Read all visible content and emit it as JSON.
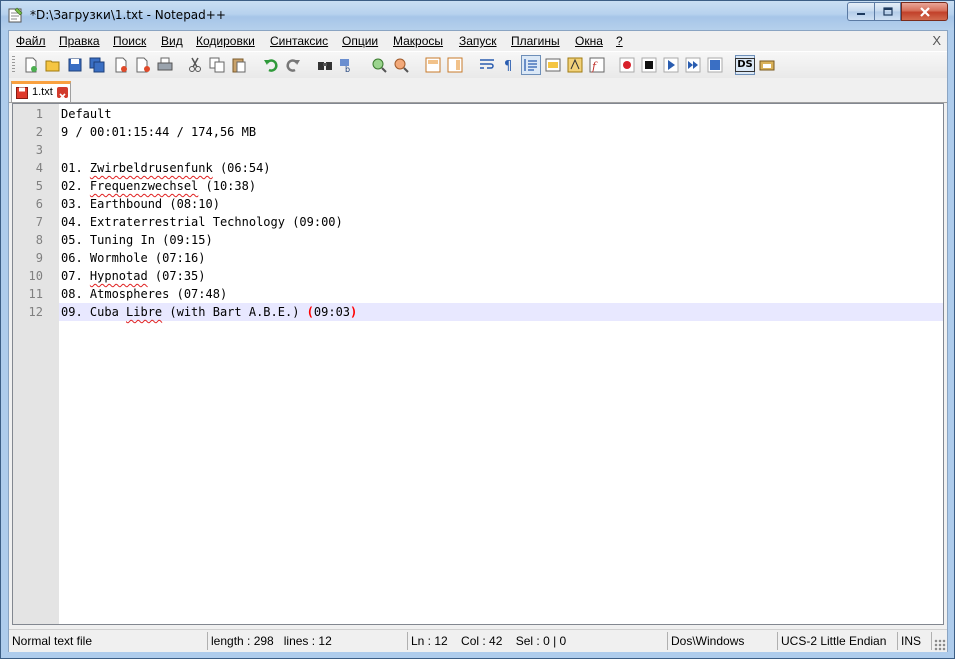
{
  "window": {
    "title": "*D:\\Загрузки\\1.txt - Notepad++",
    "buttons": {
      "minimize": "minimize-icon",
      "maximize": "maximize-icon",
      "close": "close-icon"
    }
  },
  "menu": {
    "items": [
      "Файл",
      "Правка",
      "Поиск",
      "Вид",
      "Кодировки",
      "Синтаксис",
      "Опции",
      "Макросы",
      "Запуск",
      "Плагины",
      "Окна",
      "?"
    ],
    "close": "X"
  },
  "toolbar": {
    "icons": [
      "new-file-icon",
      "open-file-icon",
      "save-icon",
      "save-all-icon",
      "close-file-icon",
      "close-all-icon",
      "print-icon",
      "cut-icon",
      "copy-icon",
      "paste-icon",
      "undo-icon",
      "redo-icon",
      "find-icon",
      "replace-icon",
      "zoom-in-icon",
      "zoom-out-icon",
      "sync-vertical-icon",
      "sync-horizontal-icon",
      "word-wrap-icon",
      "show-all-chars-icon",
      "indent-guide-icon",
      "user-lang-icon",
      "doc-map-icon",
      "function-list-icon",
      "record-macro-icon",
      "stop-record-icon",
      "play-macro-icon",
      "play-multiple-icon",
      "save-macro-icon",
      "ds-icon",
      "plugin-icon"
    ],
    "ds_label": "DS"
  },
  "tabs": [
    {
      "label": "1.txt",
      "modified": true
    }
  ],
  "editor": {
    "line_numbers": [
      "1",
      "2",
      "3",
      "4",
      "5",
      "6",
      "7",
      "8",
      "9",
      "10",
      "11",
      "12"
    ],
    "lines": [
      "Default",
      "9 / 00:01:15:44 / 174,56 MB",
      "",
      "01. Zwirbeldrusenfunk (06:54)",
      "02. Frequenzwechsel (10:38)",
      "03. Earthbound (08:10)",
      "04. Extraterrestrial Technology (09:00)",
      "05. Tuning In (09:15)",
      "06. Wormhole (07:16)",
      "07. Hypnotad (07:35)",
      "08. Atmospheres (07:48)",
      "09. Cuba Libre (with Bart A.B.E.) (09:03)"
    ],
    "current_line": 12
  },
  "statusbar": {
    "file_type": "Normal text file",
    "length": "length : 298",
    "lines": "lines : 12",
    "ln": "Ln : 12",
    "col": "Col : 42",
    "sel": "Sel : 0 | 0",
    "eol": "Dos\\Windows",
    "encoding": "UCS-2 Little Endian",
    "mode": "INS"
  }
}
